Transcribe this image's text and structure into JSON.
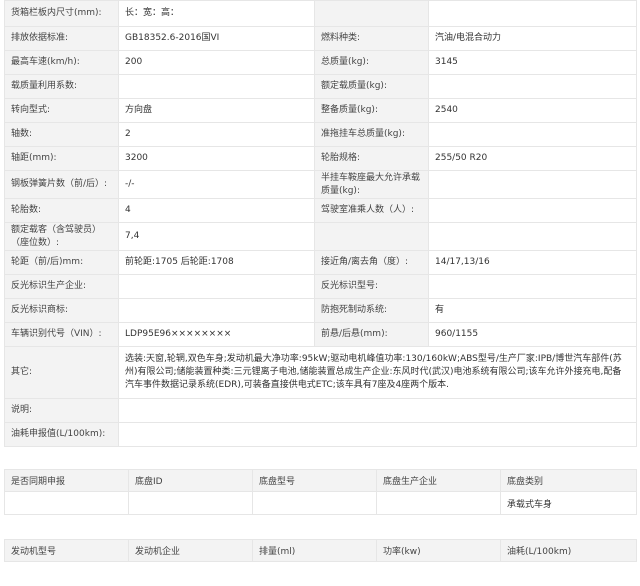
{
  "spec_rows": [
    {
      "l1": "货箱栏板内尺寸(mm):",
      "v1": "长：宽：高：",
      "l2": "",
      "v2": ""
    },
    {
      "l1": "排放依据标准:",
      "v1": "GB18352.6-2016国VI",
      "l2": "燃料种类:",
      "v2": "汽油/电混合动力"
    },
    {
      "l1": "最高车速(km/h):",
      "v1": "200",
      "l2": "总质量(kg):",
      "v2": "3145"
    },
    {
      "l1": "载质量利用系数:",
      "v1": "",
      "l2": "额定载质量(kg):",
      "v2": ""
    },
    {
      "l1": "转向型式:",
      "v1": "方向盘",
      "l2": "整备质量(kg):",
      "v2": "2540"
    },
    {
      "l1": "轴数:",
      "v1": "2",
      "l2": "准拖挂车总质量(kg):",
      "v2": ""
    },
    {
      "l1": "轴距(mm):",
      "v1": "3200",
      "l2": "轮胎规格:",
      "v2": "255/50 R20"
    },
    {
      "l1": "钢板弹簧片数（前/后）:",
      "v1": "-/-",
      "l2": "半挂车鞍座最大允许承载质量(kg):",
      "v2": ""
    },
    {
      "l1": "轮胎数:",
      "v1": "4",
      "l2": "驾驶室准乘人数（人）:",
      "v2": ""
    },
    {
      "l1": "额定载客（含驾驶员）（座位数）:",
      "v1": "7,4",
      "l2": "",
      "v2": ""
    },
    {
      "l1": "轮距（前/后)mm:",
      "v1": "前轮距:1705 后轮距:1708",
      "l2": "接近角/离去角（度）:",
      "v2": "14/17,13/16"
    },
    {
      "l1": "反光标识生产企业:",
      "v1": "",
      "l2": "反光标识型号:",
      "v2": ""
    },
    {
      "l1": "反光标识商标:",
      "v1": "",
      "l2": "防抱死制动系统:",
      "v2": "有"
    },
    {
      "l1": "车辆识别代号（VIN）:",
      "v1": "LDP95E96××××××××",
      "l2": "前悬/后悬(mm):",
      "v2": "960/1155"
    }
  ],
  "other": {
    "label": "其它:",
    "text": "选装:天窗,轮辋,双色车身;发动机最大净功率:95kW;驱动电机峰值功率:130/160kW;ABS型号/生产厂家:IPB/博世汽车部件(苏州)有限公司;储能装置种类:三元锂离子电池,储能装置总成生产企业:东风时代(武汉)电池系统有限公司;该车允许外接充电,配备汽车事件数据记录系统(EDR),可装备直接供电式ETC;该车具有7座及4座两个版本."
  },
  "note": {
    "label": "说明:",
    "text": ""
  },
  "fuel": {
    "label": "油耗申报值(L/100km):",
    "text": ""
  },
  "chassis": {
    "headers": [
      "是否同期申报",
      "底盘ID",
      "底盘型号",
      "底盘生产企业",
      "底盘类别"
    ],
    "row": [
      "",
      "",
      "",
      "",
      "承载式车身"
    ]
  },
  "engine": {
    "headers": [
      "发动机型号",
      "发动机企业",
      "排量(ml)",
      "功率(kw)",
      "油耗(L/100km)"
    ]
  }
}
